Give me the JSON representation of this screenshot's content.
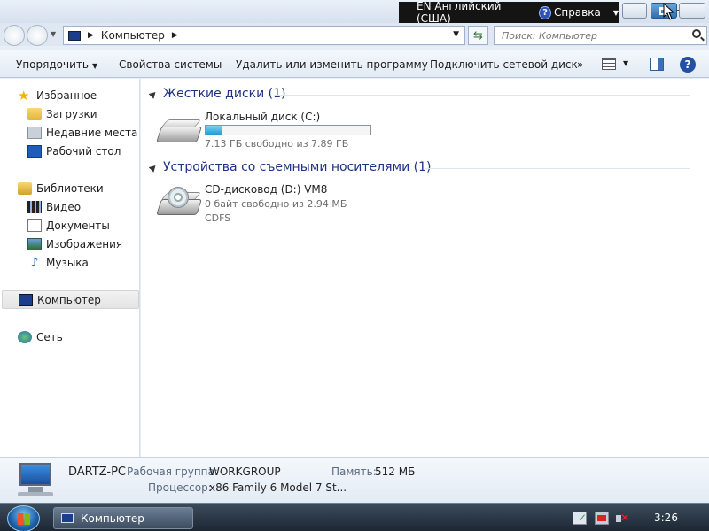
{
  "langbar": {
    "language": "EN Английский (США)",
    "help": "Справка"
  },
  "address": {
    "crumb": "Компьютер",
    "search_placeholder": "Поиск: Компьютер"
  },
  "toolbar": {
    "organize": "Упорядочить",
    "system_properties": "Свойства системы",
    "uninstall": "Удалить или изменить программу",
    "map_drive": "Подключить сетевой диск",
    "more": "»"
  },
  "sidebar": {
    "favorites": "Избранное",
    "downloads": "Загрузки",
    "recent": "Недавние места",
    "desktop": "Рабочий стол",
    "libraries": "Библиотеки",
    "video": "Видео",
    "documents": "Документы",
    "images": "Изображения",
    "music": "Музыка",
    "computer": "Компьютер",
    "network": "Сеть"
  },
  "groups": {
    "hard_disks": "Жесткие диски (1)",
    "removable": "Устройства со съемными носителями (1)"
  },
  "drives": {
    "c": {
      "name": "Локальный диск (C:)",
      "free": "7.13 ГБ свободно из 7.89 ГБ",
      "used_fraction": 0.096
    },
    "d": {
      "name": "CD-дисковод (D:) VM8",
      "free": "0 байт свободно из 2.94 МБ",
      "fs": "CDFS"
    }
  },
  "details": {
    "pc_name": "DARTZ-PC",
    "workgroup_label": "Рабочая группа:",
    "workgroup": "WORKGROUP",
    "memory_label": "Память:",
    "memory": "512 МБ",
    "cpu_label": "Процессор:",
    "cpu": "x86 Family 6 Model 7 St..."
  },
  "taskbar": {
    "window": "Компьютер",
    "clock": "3:26"
  }
}
